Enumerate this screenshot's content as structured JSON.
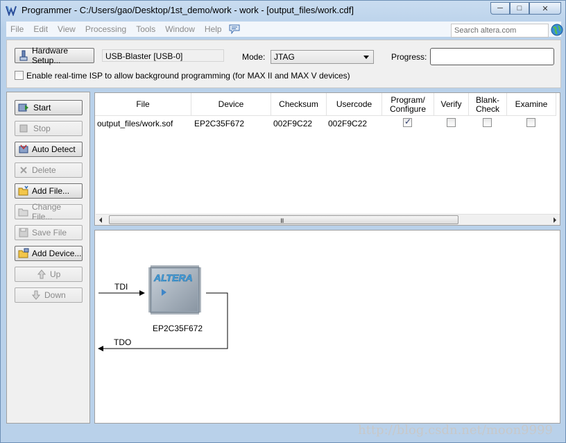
{
  "window": {
    "title": "Programmer - C:/Users/gao/Desktop/1st_demo/work - work - [output_files/work.cdf]",
    "min_glyph": "─",
    "max_glyph": "□",
    "close_glyph": "✕"
  },
  "menu": {
    "items": [
      "File",
      "Edit",
      "View",
      "Processing",
      "Tools",
      "Window",
      "Help"
    ],
    "search_placeholder": "Search altera.com"
  },
  "settings": {
    "hardware_setup_label": "Hardware Setup...",
    "hardware_value": "USB-Blaster [USB-0]",
    "mode_label": "Mode:",
    "mode_value": "JTAG",
    "progress_label": "Progress:",
    "progress_value": "",
    "isp_label": "Enable real-time ISP to allow background programming (for MAX II and MAX V devices)"
  },
  "actions": {
    "start": "Start",
    "stop": "Stop",
    "auto_detect": "Auto Detect",
    "delete": "Delete",
    "add_file": "Add File...",
    "change_file": "Change File...",
    "save_file": "Save File",
    "add_device": "Add Device...",
    "up": "Up",
    "down": "Down"
  },
  "table": {
    "columns": [
      "File",
      "Device",
      "Checksum",
      "Usercode",
      "Program/ Configure",
      "Verify",
      "Blank- Check",
      "Examine"
    ],
    "rows": [
      {
        "file": "output_files/work.sof",
        "device": "EP2C35F672",
        "checksum": "002F9C22",
        "usercode": "002F9C22",
        "program": true,
        "verify": false,
        "blank_check": false,
        "examine": false
      }
    ],
    "scroll_grip": "III"
  },
  "chain": {
    "tdi_label": "TDI",
    "tdo_label": "TDO",
    "chip_logo": "ALTERA",
    "chip_name": "EP2C35F672"
  },
  "watermark": "http://blog.csdn.net/moon9999",
  "colors": {
    "accent": "#3a7bd5",
    "chip_body": "#9aa7b4",
    "logo": "#4aa3df"
  }
}
